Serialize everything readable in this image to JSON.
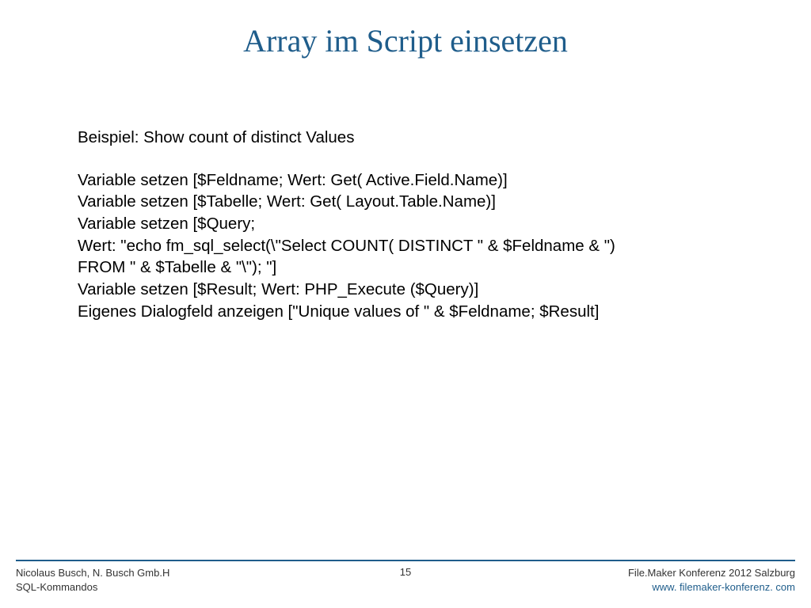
{
  "title": "Array im Script einsetzen",
  "body": {
    "intro": "Beispiel: Show count of distinct Values",
    "lines": [
      "Variable setzen [$Feldname; Wert: Get( Active.Field.Name)]",
      "Variable setzen [$Tabelle; Wert: Get( Layout.Table.Name)]",
      "Variable setzen [$Query;",
      "Wert: \"echo fm_sql_select(\\\"Select COUNT( DISTINCT \" & $Feldname & \")",
      "FROM \" & $Tabelle & \"\\\"); \"]",
      "Variable setzen [$Result; Wert: PHP_Execute ($Query)]",
      "Eigenes Dialogfeld anzeigen [\"Unique values of \" & $Feldname; $Result]"
    ]
  },
  "footer": {
    "left_line1": "Nicolaus Busch, N. Busch Gmb.H",
    "left_line2": "SQL-Kommandos",
    "page": "15",
    "right_line1": "File.Maker Konferenz 2012 Salzburg",
    "right_line2": "www. filemaker-konferenz. com"
  }
}
